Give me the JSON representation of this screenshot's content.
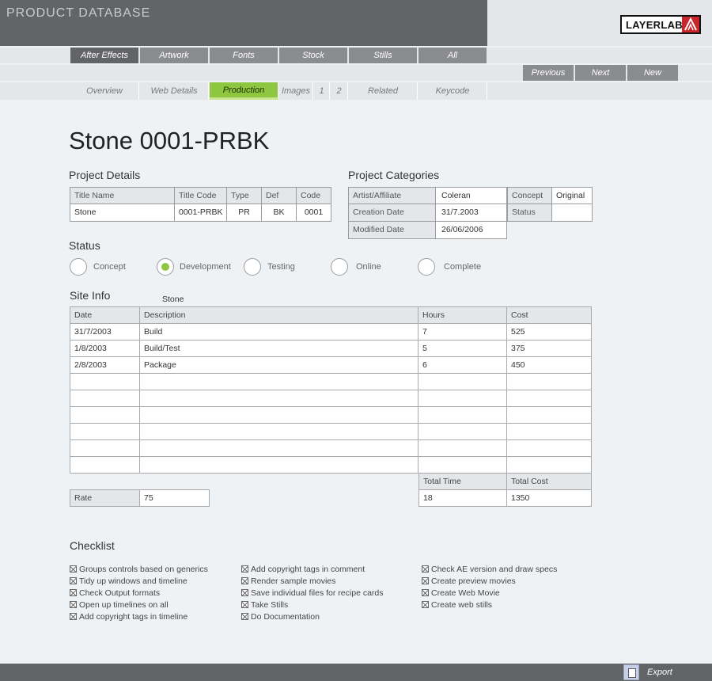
{
  "app": {
    "title": "PRODUCT DATABASE",
    "logo_text": "LAYERLAB"
  },
  "categories": [
    "After Effects",
    "Artwork",
    "Fonts",
    "Stock",
    "Stills",
    "All"
  ],
  "pager": {
    "previous": "Previous",
    "next": "Next",
    "new": "New"
  },
  "subtabs": [
    "Overview",
    "Web Details",
    "Production",
    "Images",
    "1",
    "2",
    "Related",
    "Keycode"
  ],
  "page_title": "Stone 0001-PRBK",
  "project_details": {
    "title": "Project Details",
    "headers": [
      "Title Name",
      "Title Code",
      "Type",
      "Def",
      "Code"
    ],
    "values": [
      "Stone",
      "0001-PRBK",
      "PR",
      "BK",
      "0001"
    ]
  },
  "project_categories": {
    "title": "Project Categories",
    "artist_label": "Artist/Affiliate",
    "artist_value": "Coleran",
    "creation_label": "Creation Date",
    "creation_value": "31/7.2003",
    "modified_label": "Modified Date",
    "modified_value": "26/06/2006",
    "concept_label": "Concept",
    "concept_value": "Original",
    "status_label": "Status",
    "status_value": ""
  },
  "status": {
    "title": "Status",
    "options": [
      "Concept",
      "Development",
      "Testing",
      "Online",
      "Complete"
    ],
    "selected": "Development"
  },
  "site_info": {
    "title": "Site Info",
    "name": "Stone",
    "headers": [
      "Date",
      "Description",
      "Hours",
      "Cost"
    ],
    "rows": [
      [
        "31/7/2003",
        "Build",
        "7",
        "525"
      ],
      [
        "1/8/2003",
        "Build/Test",
        "5",
        "375"
      ],
      [
        "2/8/2003",
        "Package",
        "6",
        "450"
      ],
      [
        "",
        "",
        "",
        ""
      ],
      [
        "",
        "",
        "",
        ""
      ],
      [
        "",
        "",
        "",
        ""
      ],
      [
        "",
        "",
        "",
        ""
      ],
      [
        "",
        "",
        "",
        ""
      ],
      [
        "",
        "",
        "",
        ""
      ]
    ],
    "total_time_label": "Total Time",
    "total_cost_label": "Total Cost",
    "total_time": "18",
    "total_cost": "1350",
    "rate_label": "Rate",
    "rate_value": "75"
  },
  "checklist": {
    "title": "Checklist",
    "columns": [
      [
        "Groups controls based on generics",
        "Tidy up windows and timeline",
        "Check Output formats",
        "Open up timelines on all",
        "Add copyright tags in timeline"
      ],
      [
        "Add copyright tags in comment",
        "Render sample movies",
        "Save individual files for recipe cards",
        "Take Stills",
        "Do Documentation"
      ],
      [
        "Check AE version and draw specs",
        "Create preview movies",
        "Create Web Movie",
        "Create web stills"
      ]
    ]
  },
  "footer": {
    "export": "Export"
  }
}
